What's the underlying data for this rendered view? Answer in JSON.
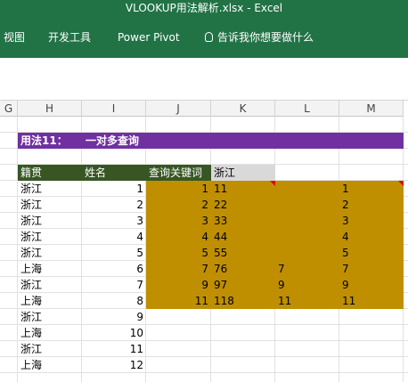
{
  "window": {
    "title": "VLOOKUP用法解析.xlsx  -  Excel"
  },
  "ribbon": {
    "tabs": [
      "视图",
      "开发工具",
      "Power Pivot"
    ],
    "tell_me": "告诉我你想要做什么"
  },
  "columns": [
    "G",
    "H",
    "I",
    "J",
    "K",
    "L",
    "M"
  ],
  "section": {
    "label": "用法11：",
    "title": "一对多查询"
  },
  "headers": {
    "region": "籍贯",
    "name": "姓名",
    "query": "查询关键词",
    "query_value": "浙江"
  },
  "rows": [
    {
      "region": "浙江",
      "name": "1",
      "j": "1",
      "k": "11",
      "l": "",
      "m": "1"
    },
    {
      "region": "浙江",
      "name": "2",
      "j": "2",
      "k": "22",
      "l": "",
      "m": "2"
    },
    {
      "region": "浙江",
      "name": "3",
      "j": "3",
      "k": "33",
      "l": "",
      "m": "3"
    },
    {
      "region": "浙江",
      "name": "4",
      "j": "4",
      "k": "44",
      "l": "",
      "m": "4"
    },
    {
      "region": "浙江",
      "name": "5",
      "j": "5",
      "k": "55",
      "l": "",
      "m": "5"
    },
    {
      "region": "上海",
      "name": "6",
      "j": "7",
      "k": "76",
      "l": "7",
      "m": "7"
    },
    {
      "region": "浙江",
      "name": "7",
      "j": "9",
      "k": "97",
      "l": "9",
      "m": "9"
    },
    {
      "region": "上海",
      "name": "8",
      "j": "11",
      "k": "118",
      "l": "11",
      "m": "11"
    },
    {
      "region": "浙江",
      "name": "9",
      "j": "",
      "k": "",
      "l": "",
      "m": ""
    },
    {
      "region": "上海",
      "name": "10",
      "j": "",
      "k": "",
      "l": "",
      "m": ""
    },
    {
      "region": "浙江",
      "name": "11",
      "j": "",
      "k": "",
      "l": "",
      "m": ""
    },
    {
      "region": "上海",
      "name": "12",
      "j": "",
      "k": "",
      "l": "",
      "m": ""
    }
  ],
  "colors": {
    "excel_green": "#217346",
    "section_purple": "#7030a0",
    "header_green": "#375623",
    "gold_fill": "#bf8f00",
    "query_gray": "#d9d9d9",
    "comment_red": "#e00000"
  }
}
